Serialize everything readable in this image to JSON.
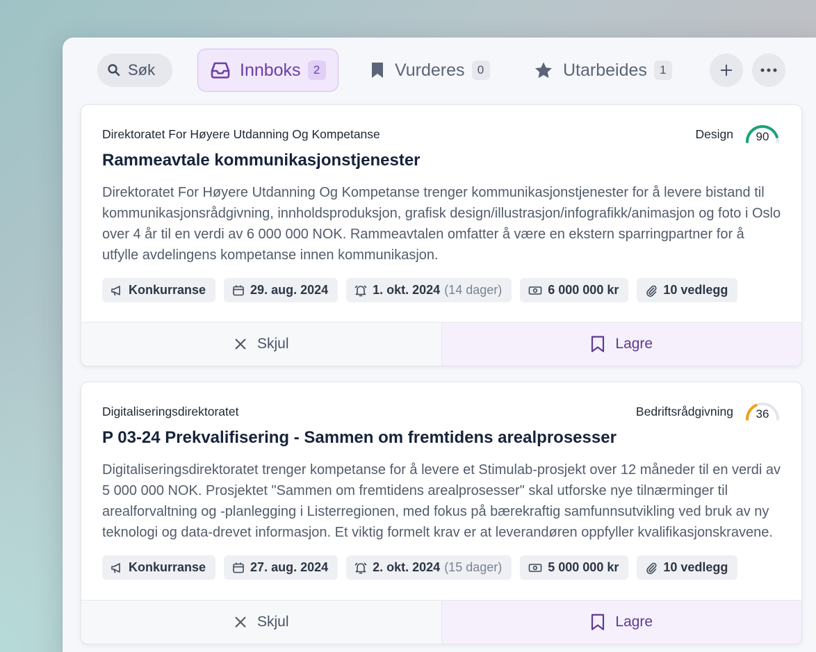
{
  "toolbar": {
    "search_label": "Søk",
    "tabs": [
      {
        "label": "Innboks",
        "count": "2"
      },
      {
        "label": "Vurderes",
        "count": "0"
      },
      {
        "label": "Utarbeides",
        "count": "1"
      }
    ]
  },
  "cards": [
    {
      "organization": "Direktoratet For Høyere Utdanning Og Kompetanse",
      "category": "Design",
      "score": "90",
      "score_value": 90,
      "score_color": "#1aa37a",
      "title": "Rammeavtale kommunikasjonstjenester",
      "description": "Direktoratet For Høyere Utdanning Og Kompetanse trenger kommunikasjonstjenester for å levere bistand til kommunikasjonsrådgivning, innholdsproduksjon, grafisk design/illustrasjon/infografikk/animasjon og foto i Oslo over 4 år til en verdi av 6 000 000 NOK. Rammeavtalen omfatter å være en ekstern sparringpartner for å utfylle avdelingens kompetanse innen kommunikasjon.",
      "meta": {
        "type": "Konkurranse",
        "published": "29. aug. 2024",
        "deadline": "1. okt. 2024",
        "deadline_rel": "(14 dager)",
        "value": "6 000 000 kr",
        "attachments": "10 vedlegg"
      },
      "hide_label": "Skjul",
      "save_label": "Lagre"
    },
    {
      "organization": "Digitaliseringsdirektoratet",
      "category": "Bedriftsrådgivning",
      "score": "36",
      "score_value": 36,
      "score_color": "#f2a01c",
      "title": "P 03-24 Prekvalifisering - Sammen om fremtidens arealprosesser",
      "description": "Digitaliseringsdirektoratet trenger kompetanse for å levere et Stimulab-prosjekt over 12 måneder til en verdi av 5 000 000 NOK. Prosjektet \"Sammen om fremtidens arealprosesser\" skal utforske nye tilnærminger til arealforvaltning og -planlegging i Listerregionen, med fokus på bærekraftig samfunnsutvikling ved bruk av ny teknologi og data-drevet informasjon. Et viktig formelt krav er at leverandøren oppfyller kvalifikasjonskravene.",
      "meta": {
        "type": "Konkurranse",
        "published": "27. aug. 2024",
        "deadline": "2. okt. 2024",
        "deadline_rel": "(15 dager)",
        "value": "5 000 000 kr",
        "attachments": "10 vedlegg"
      },
      "hide_label": "Skjul",
      "save_label": "Lagre"
    }
  ]
}
